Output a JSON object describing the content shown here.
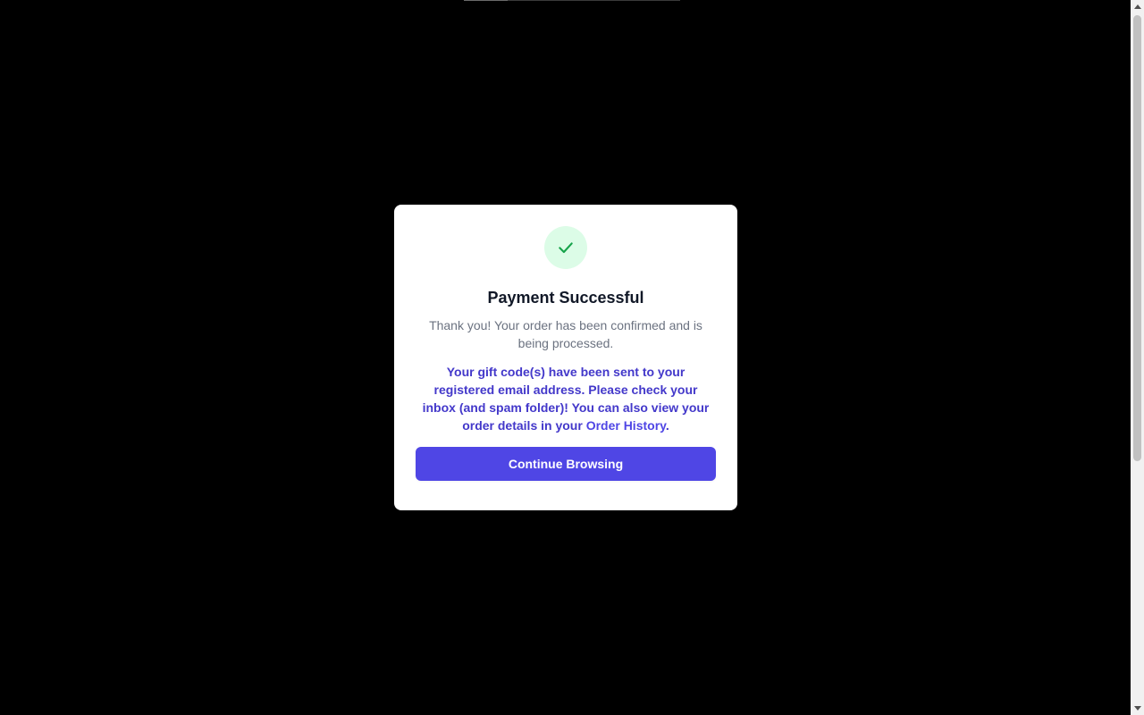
{
  "modal": {
    "title": "Payment Successful",
    "message": "Thank you! Your order has been confirmed and is being processed.",
    "note_prefix": "Your gift code(s) have been sent to your registered email address. Please check your inbox (and spam folder)! You can also view your order details in your ",
    "note_link": "Order History",
    "note_suffix": ".",
    "button_label": "Continue Browsing",
    "icon": "check-icon"
  },
  "colors": {
    "backdrop": "#000000",
    "accent": "#4f46e5",
    "success_bg": "#dcfce7",
    "success_fg": "#16a34a"
  }
}
